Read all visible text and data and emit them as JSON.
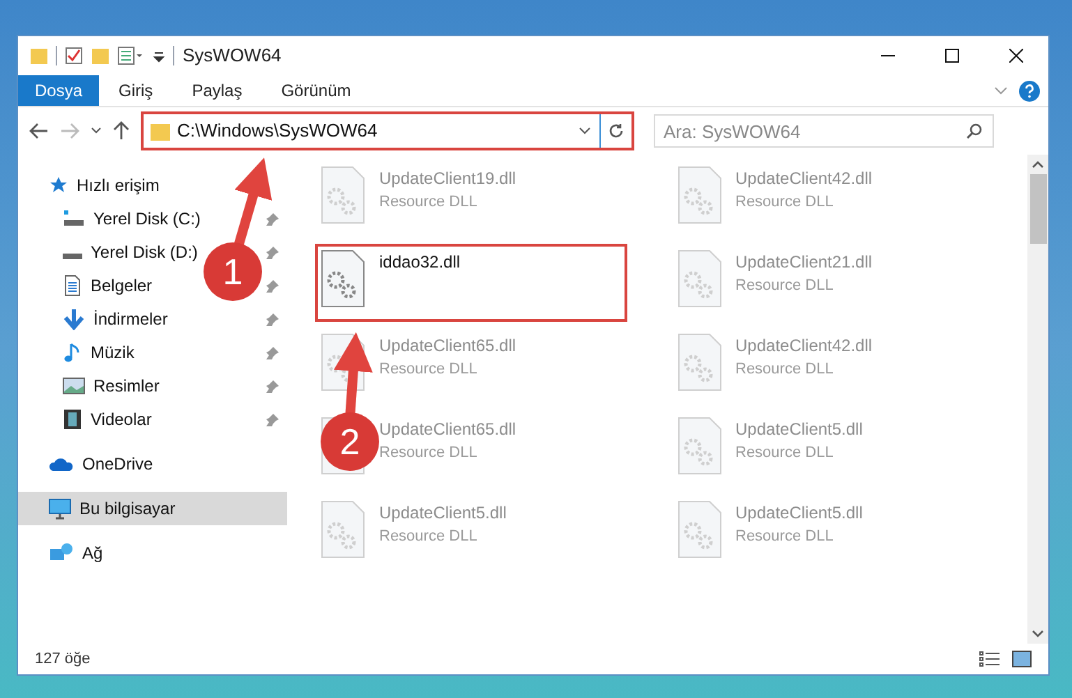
{
  "window": {
    "title": "SysWOW64"
  },
  "ribbon_tabs": [
    {
      "label": "Dosya",
      "selected": true
    },
    {
      "label": "Giriş",
      "selected": false
    },
    {
      "label": "Paylaş",
      "selected": false
    },
    {
      "label": "Görünüm",
      "selected": false
    }
  ],
  "address_bar": {
    "path": "C:\\Windows\\SysWOW64",
    "highlighted": true
  },
  "search": {
    "placeholder": "Ara: SysWOW64"
  },
  "sidebar": {
    "items": [
      {
        "label": "Hızlı erişim",
        "kind": "header",
        "pinned": false,
        "selected": false
      },
      {
        "label": "Yerel Disk (C:)",
        "kind": "sub",
        "pinned": true,
        "selected": false
      },
      {
        "label": "Yerel Disk (D:)",
        "kind": "sub",
        "pinned": true,
        "selected": false
      },
      {
        "label": "Belgeler",
        "kind": "sub",
        "pinned": true,
        "selected": false
      },
      {
        "label": "İndirmeler",
        "kind": "sub",
        "pinned": true,
        "selected": false
      },
      {
        "label": "Müzik",
        "kind": "sub",
        "pinned": true,
        "selected": false
      },
      {
        "label": "Resimler",
        "kind": "sub",
        "pinned": true,
        "selected": false
      },
      {
        "label": "Videolar",
        "kind": "sub",
        "pinned": true,
        "selected": false
      },
      {
        "label": "OneDrive",
        "kind": "header",
        "pinned": false,
        "selected": false
      },
      {
        "label": "Bu bilgisayar",
        "kind": "header",
        "pinned": false,
        "selected": true
      },
      {
        "label": "Ağ",
        "kind": "header",
        "pinned": false,
        "selected": false
      }
    ]
  },
  "files": [
    {
      "name": "UpdateClient19.dll",
      "type": "Resource DLL",
      "blurred": true,
      "highlighted": false
    },
    {
      "name": "UpdateClient42.dll",
      "type": "Resource DLL",
      "blurred": true,
      "highlighted": false
    },
    {
      "name": "iddao32.dll",
      "blurred": false,
      "highlighted": true
    },
    {
      "name": "UpdateClient21.dll",
      "type": "Resource DLL",
      "blurred": true,
      "highlighted": false
    },
    {
      "name": "UpdateClient65.dll",
      "type": "Resource DLL",
      "blurred": true,
      "highlighted": false
    },
    {
      "name": "UpdateClient42.dll",
      "type": "Resource DLL",
      "blurred": true,
      "highlighted": false
    },
    {
      "name": "UpdateClient65.dll",
      "type": "Resource DLL",
      "blurred": true,
      "highlighted": false
    },
    {
      "name": "UpdateClient5.dll",
      "type": "Resource DLL",
      "blurred": true,
      "highlighted": false
    },
    {
      "name": "UpdateClient5.dll",
      "type": "Resource DLL",
      "blurred": true,
      "highlighted": false
    },
    {
      "name": "UpdateClient5.dll",
      "type": "Resource DLL",
      "blurred": true,
      "highlighted": false
    }
  ],
  "status_bar": {
    "count": "127 öğe"
  },
  "annotations": [
    {
      "number": "1"
    },
    {
      "number": "2"
    }
  ]
}
